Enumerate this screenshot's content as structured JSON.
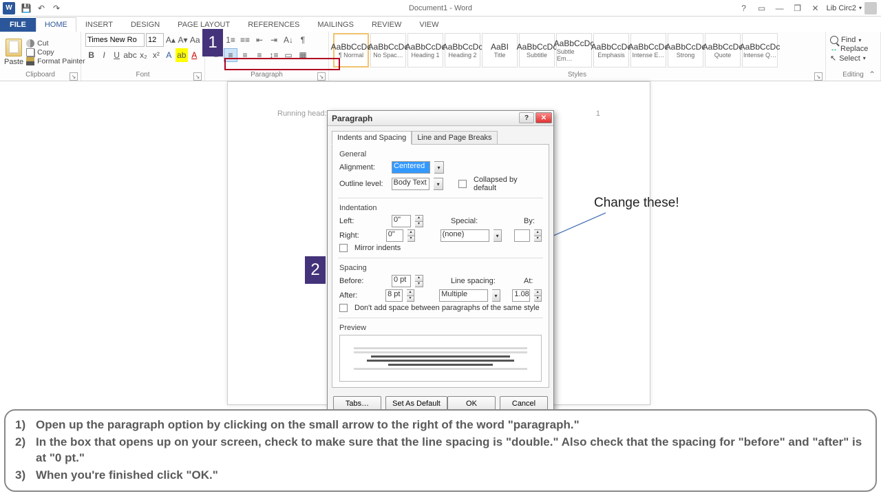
{
  "app": {
    "title": "Document1 - Word",
    "user": "Lib Circ2",
    "icon_letter": "W"
  },
  "qat": {
    "save": "💾",
    "undo": "↶",
    "redo": "↷"
  },
  "window_controls": {
    "help": "?",
    "ribbon_opts": "▭",
    "min": "—",
    "restore": "❐",
    "close": "✕"
  },
  "tabs": {
    "file": "FILE",
    "home": "HOME",
    "insert": "INSERT",
    "design": "DESIGN",
    "layout": "PAGE LAYOUT",
    "references": "REFERENCES",
    "mailings": "MAILINGS",
    "review": "REVIEW",
    "view": "VIEW"
  },
  "ribbon": {
    "clipboard": {
      "label": "Clipboard",
      "paste": "Paste",
      "cut": "Cut",
      "copy": "Copy",
      "format_painter": "Format Painter"
    },
    "font": {
      "label": "Font",
      "name": "Times New Ro",
      "size": "12"
    },
    "paragraph": {
      "label": "Paragraph"
    },
    "styles": {
      "label": "Styles",
      "items": [
        {
          "name": "Normal",
          "prev": "AaBbCcDc",
          "sel": true
        },
        {
          "name": "No Spac…",
          "prev": "AaBbCcDc"
        },
        {
          "name": "Heading 1",
          "prev": "AaBbCcDc"
        },
        {
          "name": "Heading 2",
          "prev": "AaBbCcDc"
        },
        {
          "name": "Title",
          "prev": "AaBI"
        },
        {
          "name": "Subtitle",
          "prev": "AaBbCcDc"
        },
        {
          "name": "Subtle Em…",
          "prev": "AaBbCcDc"
        },
        {
          "name": "Emphasis",
          "prev": "AaBbCcDc"
        },
        {
          "name": "Intense E…",
          "prev": "AaBbCcDc"
        },
        {
          "name": "Strong",
          "prev": "AaBbCcDc"
        },
        {
          "name": "Quote",
          "prev": "AaBbCcDc"
        },
        {
          "name": "Intense Q…",
          "prev": "AaBbCcDc"
        }
      ]
    },
    "editing": {
      "label": "Editing",
      "find": "Find",
      "replace": "Replace",
      "select": "Select"
    }
  },
  "page": {
    "running_head": "Running head: SAMPLE APA PAPER",
    "page_no": "1"
  },
  "callouts": {
    "one": "1",
    "two": "2",
    "annot": "Change these!"
  },
  "dialog": {
    "title": "Paragraph",
    "tabs": {
      "indents": "Indents and Spacing",
      "breaks": "Line and Page Breaks"
    },
    "general": {
      "header": "General",
      "alignment_label": "Alignment:",
      "alignment_value": "Centered",
      "outline_label": "Outline level:",
      "outline_value": "Body Text",
      "collapsed": "Collapsed by default"
    },
    "indent": {
      "header": "Indentation",
      "left_label": "Left:",
      "left_value": "0\"",
      "right_label": "Right:",
      "right_value": "0\"",
      "special_label": "Special:",
      "special_value": "(none)",
      "by_label": "By:",
      "by_value": "",
      "mirror": "Mirror indents"
    },
    "spacing": {
      "header": "Spacing",
      "before_label": "Before:",
      "before_value": "0 pt",
      "after_label": "After:",
      "after_value": "8 pt",
      "ls_label": "Line spacing:",
      "ls_value": "Multiple",
      "at_label": "At:",
      "at_value": "1.08",
      "same_style": "Don't add space between paragraphs of the same style"
    },
    "preview": "Preview",
    "buttons": {
      "tabs": "Tabs…",
      "default": "Set As Default",
      "ok": "OK",
      "cancel": "Cancel"
    }
  },
  "instructions": {
    "i1": "Open up the paragraph option by clicking on the small arrow to the right of the word \"paragraph.\"",
    "i2": "In the box that opens up on your screen, check to make sure that the line spacing is \"double.\"  Also check that the spacing for \"before\" and \"after\" is at \"0 pt.\"",
    "i3": "When you're finished click \"OK.\""
  }
}
